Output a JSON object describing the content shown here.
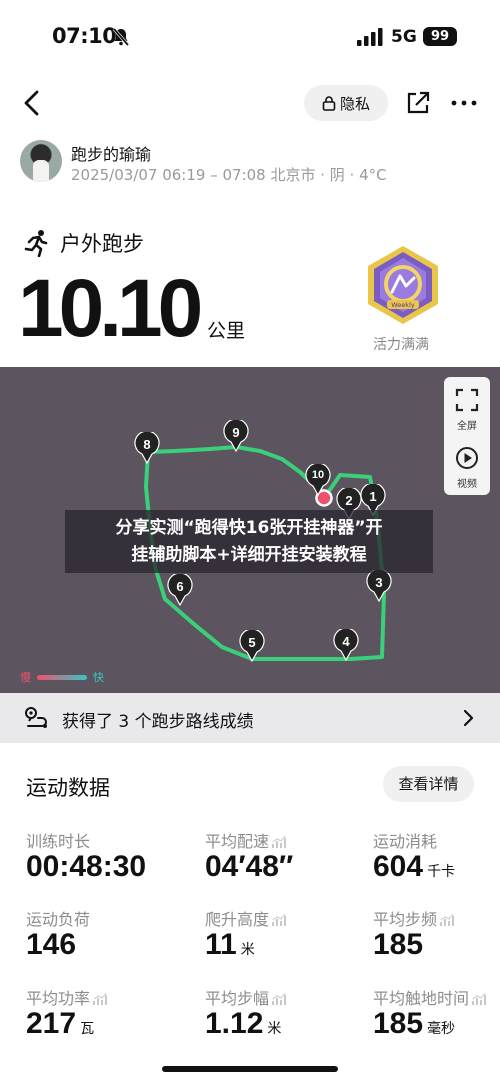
{
  "status_bar": {
    "time": "07:10",
    "network": "5G",
    "battery": "99"
  },
  "nav": {
    "privacy_label": "隐私"
  },
  "user": {
    "name": "跑步的瑜瑜",
    "meta": "2025/03/07 06:19 – 07:08 北京市 · 阴 · 4°C"
  },
  "activity": {
    "type": "户外跑步",
    "distance": "10.10",
    "unit": "公里",
    "badge_text": "Weekly",
    "badge_label": "活力满满"
  },
  "map": {
    "fullscreen_label": "全屏",
    "video_label": "视频",
    "speed_slow": "慢",
    "speed_fast": "快",
    "overlay_text_1": "分享实测“跑得快16张开挂神器”开",
    "overlay_text_2": "挂辅助脚本+详细开挂安装教程",
    "markers": [
      {
        "label": "1"
      },
      {
        "label": "2"
      },
      {
        "label": "3"
      },
      {
        "label": "4"
      },
      {
        "label": "5"
      },
      {
        "label": "6"
      },
      {
        "label": "8"
      },
      {
        "label": "9"
      },
      {
        "label": "10"
      }
    ],
    "route_color": "#3ad07a"
  },
  "achievement": {
    "text": "获得了 3 个跑步路线成绩"
  },
  "stats": {
    "title": "运动数据",
    "details_label": "查看详情",
    "items": [
      {
        "label": "训练时长",
        "value": "00:48:30",
        "unit": "",
        "trend": false
      },
      {
        "label": "平均配速",
        "value": "04′48″",
        "unit": "",
        "trend": true
      },
      {
        "label": "运动消耗",
        "value": "604",
        "unit": "千卡",
        "trend": false
      },
      {
        "label": "运动负荷",
        "value": "146",
        "unit": "",
        "trend": false
      },
      {
        "label": "爬升高度",
        "value": "11",
        "unit": "米",
        "trend": true
      },
      {
        "label": "平均步频",
        "value": "185",
        "unit": "",
        "trend": true
      },
      {
        "label": "平均功率",
        "value": "217",
        "unit": "瓦",
        "trend": true
      },
      {
        "label": "平均步幅",
        "value": "1.12",
        "unit": "米",
        "trend": true
      },
      {
        "label": "平均触地时间",
        "value": "185",
        "unit": "毫秒",
        "trend": true
      }
    ]
  },
  "colors": {
    "map_bg": "#5c5560",
    "slow": "#f0506e",
    "fast": "#35c7c0"
  }
}
